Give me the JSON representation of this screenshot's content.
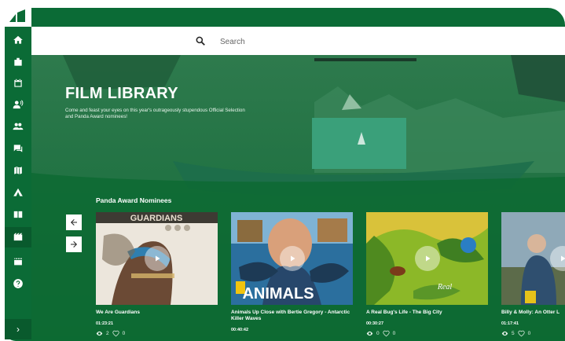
{
  "search": {
    "placeholder": "Search"
  },
  "hero": {
    "title": "FILM LIBRARY",
    "subtitle": "Come and feast your eyes on this year's outrageously stupendous Official Selection and Panda Award nominees!"
  },
  "section": {
    "title": "Panda Award Nominees"
  },
  "sidebar": {
    "icons": [
      "home-icon",
      "badge-icon",
      "calendar-icon",
      "speaker-icon",
      "people-icon",
      "chat-icon",
      "map-icon",
      "tent-icon",
      "book-icon",
      "film-icon",
      "clapper-icon",
      "help-icon"
    ],
    "active": "film-icon",
    "expand_label": "›"
  },
  "films": [
    {
      "title": "We Are Guardians",
      "duration": "01:23:21",
      "views": "2",
      "likes": "0",
      "poster_text": "GUARDIANS"
    },
    {
      "title": "Animals Up Close with Bertie Gregory - Antarctic Killer Waves",
      "duration": "00:40:42",
      "views": "",
      "likes": "",
      "poster_text": "ANIMALS"
    },
    {
      "title": "A Real Bug's Life - The Big City",
      "duration": "00:30:27",
      "views": "0",
      "likes": "0",
      "poster_text": "Real"
    },
    {
      "title": "Billy & Molly: An Otter L",
      "duration": "01:17:41",
      "views": "5",
      "likes": "0",
      "poster_text": ""
    }
  ],
  "colors": {
    "brand_green": "#0b6b36",
    "main_green": "#0d6a33",
    "white": "#ffffff"
  }
}
